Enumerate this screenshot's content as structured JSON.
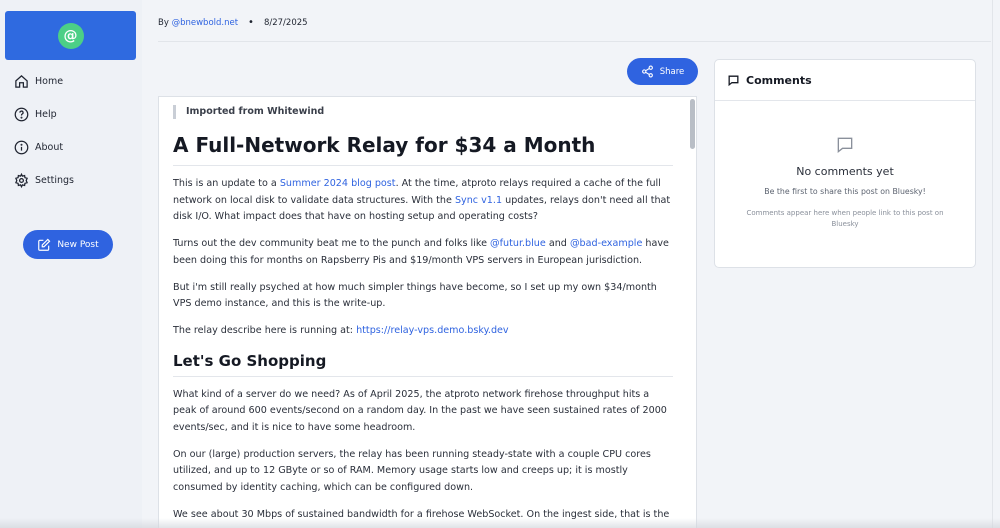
{
  "sidebar": {
    "logo_glyph": "@",
    "items": [
      {
        "label": "Home",
        "icon": "home-icon"
      },
      {
        "label": "Help",
        "icon": "help-icon"
      },
      {
        "label": "About",
        "icon": "info-icon"
      },
      {
        "label": "Settings",
        "icon": "gear-icon"
      }
    ],
    "new_post_label": "New Post"
  },
  "byline": {
    "prefix": "By",
    "author": "@bnewbold.net",
    "separator": "•",
    "date": "8/27/2025"
  },
  "share_label": "Share",
  "article": {
    "imported_label": "Imported from Whitewind",
    "title": "A Full-Network Relay for $34 a Month",
    "p1": {
      "t1": "This is an update to a ",
      "link1": "Summer 2024 blog post",
      "t2": ". At the time, atproto relays required a cache of the full network on local disk to validate data structures. With the ",
      "link2": "Sync v1.1",
      "t3": " updates, relays don't need all that disk I/O. What impact does that have on hosting setup and operating costs?"
    },
    "p2": {
      "t1": "Turns out the dev community beat me to the punch and folks like ",
      "link1": "@futur.blue",
      "t2": " and ",
      "link2": "@bad-example",
      "t3": " have been doing this for months on Rapsberry Pis and $19/month VPS servers in European jurisdiction."
    },
    "p3": "But i'm still really psyched at how much simpler things have become, so I set up my own $34/month VPS demo instance, and this is the write-up.",
    "p4": {
      "t1": "The relay describe here is running at: ",
      "link1": "https://relay-vps.demo.bsky.dev"
    },
    "h2": "Let's Go Shopping",
    "p5": "What kind of a server do we need? As of April 2025, the atproto network firehose throughput hits a peak of around 600 events/second on a random day. In the past we have seen sustained rates of 2000 events/sec, and it is nice to have some headroom.",
    "p6": "On our (large) production servers, the relay has been running steady-state with a couple CPU cores utilized, and up to 12 GByte or so of RAM. Memory usage starts low and creeps up; it is mostly consumed by identity caching, which can be configured down.",
    "p7": "We see about 30 Mbps of sustained bandwidth for a firehose WebSocket. On the ingest side, that is the"
  },
  "comments": {
    "title": "Comments",
    "empty_title": "No comments yet",
    "empty_sub": "Be the first to share this post on Bluesky!",
    "hint": "Comments appear here when people link to this post on Bluesky"
  },
  "colors": {
    "accent": "#2f63e0",
    "logo_green": "#4ccf86"
  }
}
